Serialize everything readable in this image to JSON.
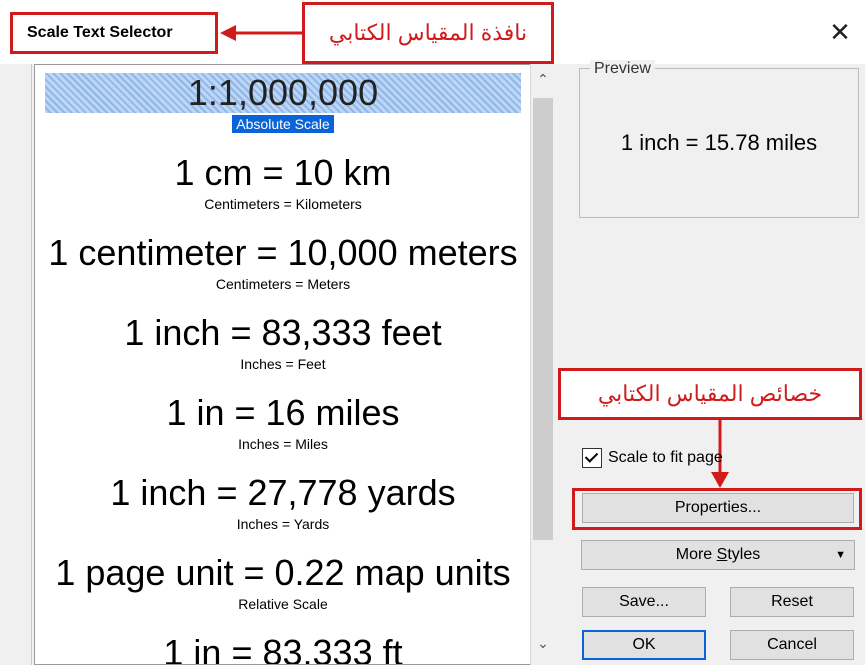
{
  "window": {
    "title": "Scale Text Selector",
    "close_glyph": "✕"
  },
  "annotations": {
    "title_label": "نافذة المقياس الكتابي",
    "properties_label": "خصائص المقياس الكتابي",
    "color": "#d11b1b"
  },
  "scale_list": {
    "items": [
      {
        "big": "1:1,000,000",
        "small": "Absolute Scale",
        "selected": true
      },
      {
        "big": "1 cm = 10 km",
        "small": "Centimeters = Kilometers"
      },
      {
        "big": "1 centimeter = 10,000 meters",
        "small": "Centimeters = Meters"
      },
      {
        "big": "1 inch = 83,333 feet",
        "small": "Inches = Feet"
      },
      {
        "big": "1 in = 16 miles",
        "small": "Inches = Miles"
      },
      {
        "big": "1 inch = 27,778 yards",
        "small": "Inches = Yards"
      },
      {
        "big": "1 page unit = 0.22 map units",
        "small": "Relative Scale"
      },
      {
        "big": "1 in = 83,333 ft",
        "small": ""
      }
    ],
    "scroll_up_icon": "up-arrow-icon",
    "scroll_down_icon": "down-arrow-icon"
  },
  "preview": {
    "legend": "Preview",
    "text": "1 inch = 15.78 miles"
  },
  "options": {
    "scale_to_fit_label": "Scale to fit page",
    "scale_to_fit_checked": true
  },
  "buttons": {
    "properties": "Properties...",
    "more_styles_prefix": "More ",
    "more_styles_underlined": "S",
    "more_styles_suffix": "tyles",
    "more_styles_caret": "▼",
    "save": "Save...",
    "reset": "Reset",
    "ok": "OK",
    "cancel": "Cancel"
  },
  "colors": {
    "selection": "#0a64d8",
    "highlight_stripes": "#8fb7ea"
  }
}
